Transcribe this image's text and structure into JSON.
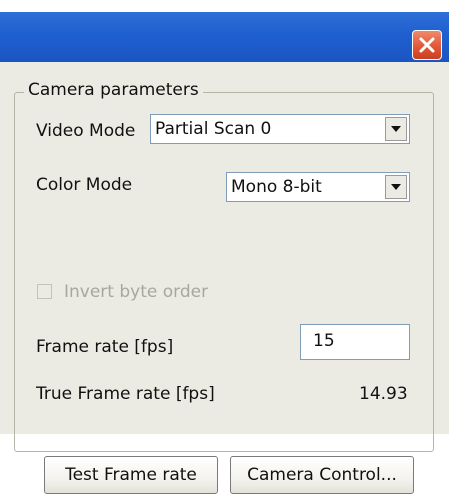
{
  "window": {
    "close_icon": "close-x-icon",
    "colors": {
      "titlebar": "#1e5fcf",
      "close": "#e2583a",
      "dialog_bg": "#ecebe3"
    }
  },
  "group": {
    "label": "Camera parameters"
  },
  "video_mode": {
    "label": "Video Mode",
    "value": "Partial Scan 0"
  },
  "color_mode": {
    "label": "Color Mode",
    "value": "Mono 8-bit"
  },
  "invert": {
    "label": "Invert byte order",
    "checked": false,
    "enabled": false
  },
  "frame_rate": {
    "label": "Frame rate [fps]",
    "value": "15"
  },
  "true_frame_rate": {
    "label": "True Frame rate [fps]",
    "value": "14.93"
  },
  "buttons": {
    "test_frame_rate": "Test Frame rate",
    "camera_control": "Camera Control..."
  }
}
